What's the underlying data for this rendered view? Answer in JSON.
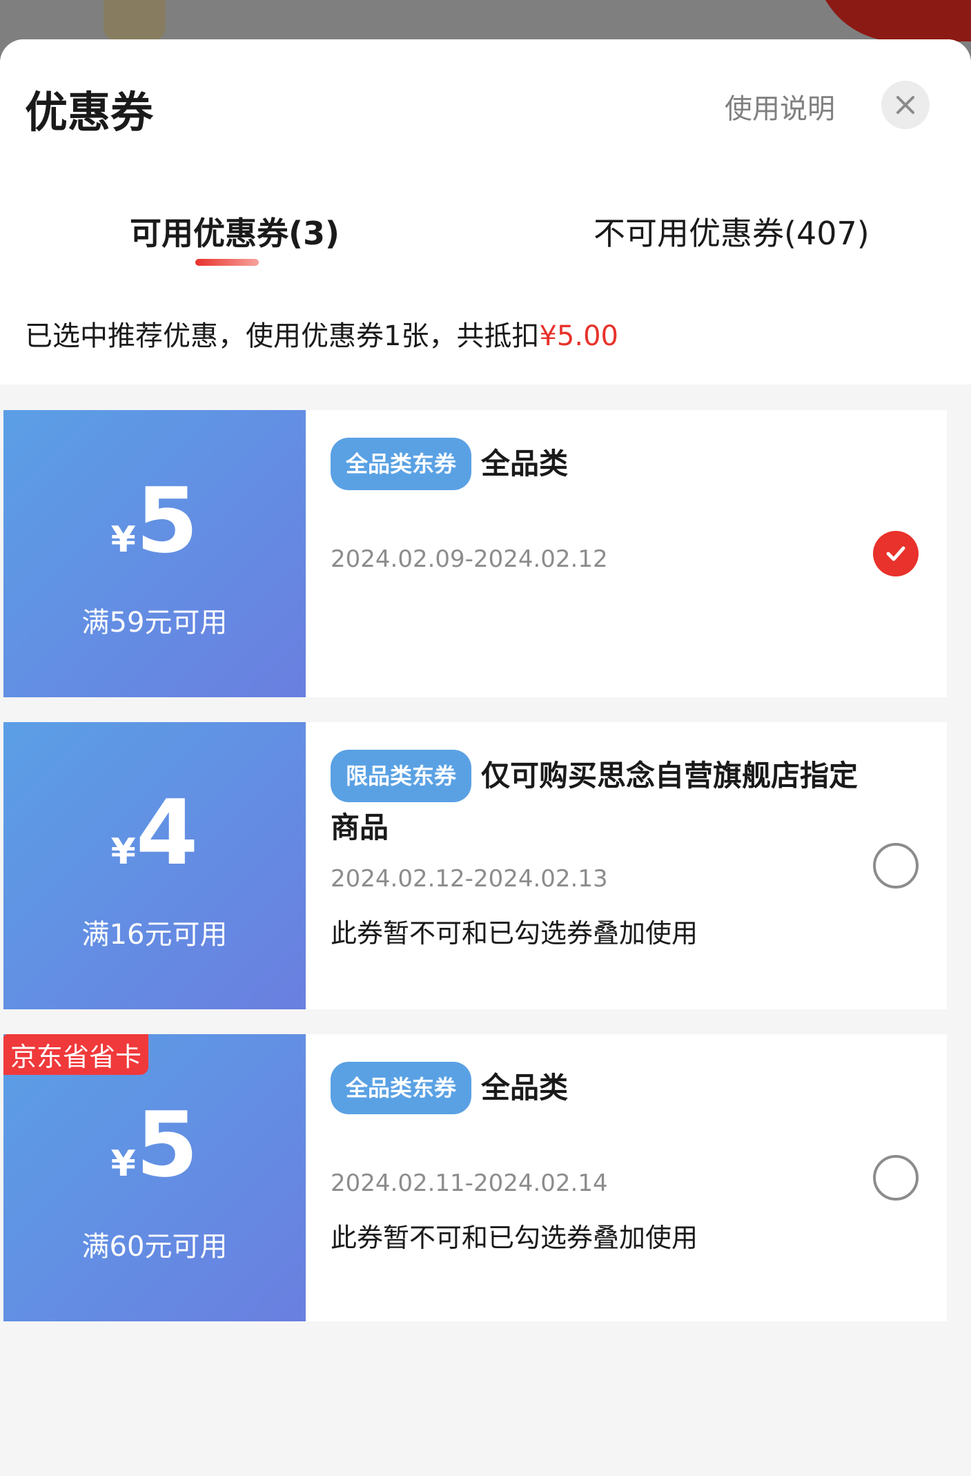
{
  "header": {
    "title": "优惠券",
    "help_label": "使用说明",
    "close_icon": "close-icon"
  },
  "tabs": [
    {
      "label": "可用优惠券(3)",
      "active": true
    },
    {
      "label": "不可用优惠券(407)",
      "active": false
    }
  ],
  "summary": {
    "text": "已选中推荐优惠，使用优惠券1张，共抵扣",
    "amount": "¥5.00"
  },
  "coupons": [
    {
      "yen": "¥",
      "value": "5",
      "condition": "满59元可用",
      "tag": "全品类东券",
      "scope": "全品类",
      "date": "2024.02.09-2024.02.12",
      "note": "",
      "selected": true,
      "corner_badge": ""
    },
    {
      "yen": "¥",
      "value": "4",
      "condition": "满16元可用",
      "tag": "限品类东券",
      "scope": "仅可购买思念自营旗舰店指定商品",
      "date": "2024.02.12-2024.02.13",
      "note": "此券暂不可和已勾选券叠加使用",
      "selected": false,
      "corner_badge": ""
    },
    {
      "yen": "¥",
      "value": "5",
      "condition": "满60元可用",
      "tag": "全品类东券",
      "scope": "全品类",
      "date": "2024.02.11-2024.02.14",
      "note": "此券暂不可和已勾选券叠加使用",
      "selected": false,
      "corner_badge": "京东省省卡"
    }
  ],
  "colors": {
    "accent_red": "#e8322b",
    "coupon_blue": "#5b9fe6",
    "tag_blue": "#5aa1e4"
  }
}
